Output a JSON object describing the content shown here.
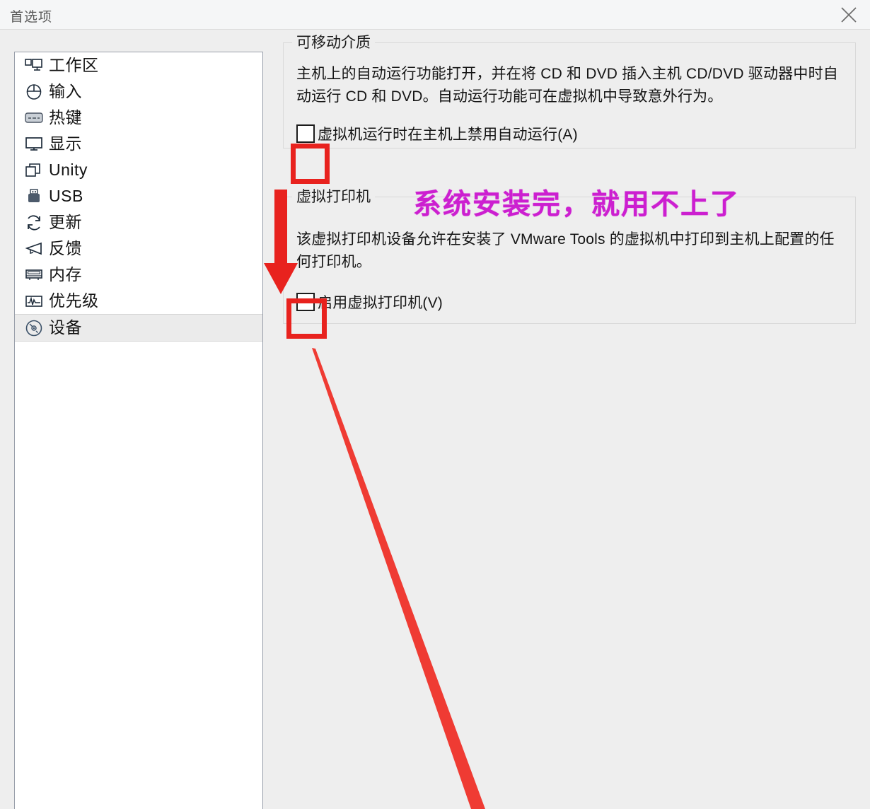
{
  "window": {
    "title": "首选项",
    "close_label": "×",
    "close_icon": "close-icon"
  },
  "sidebar": {
    "items": [
      {
        "label": "工作区",
        "icon": "workspace-icon",
        "selected": false
      },
      {
        "label": "输入",
        "icon": "mouse-icon",
        "selected": false
      },
      {
        "label": "热键",
        "icon": "keyboard-key-icon",
        "selected": false
      },
      {
        "label": "显示",
        "icon": "monitor-icon",
        "selected": false
      },
      {
        "label": "Unity",
        "icon": "windows-overlap-icon",
        "selected": false
      },
      {
        "label": "USB",
        "icon": "usb-stick-icon",
        "selected": false
      },
      {
        "label": "更新",
        "icon": "refresh-icon",
        "selected": false
      },
      {
        "label": "反馈",
        "icon": "megaphone-icon",
        "selected": false
      },
      {
        "label": "内存",
        "icon": "memory-module-icon",
        "selected": false
      },
      {
        "label": "优先级",
        "icon": "waveform-chart-icon",
        "selected": false
      },
      {
        "label": "设备",
        "icon": "disc-icon",
        "selected": true
      }
    ]
  },
  "main": {
    "groups": [
      {
        "legend": "可移动介质",
        "description": "主机上的自动运行功能打开，并在将 CD 和 DVD 插入主机 CD/DVD 驱动器中时自动运行 CD 和 DVD。自动运行功能可在虚拟机中导致意外行为。",
        "checkbox": {
          "label": "虚拟机运行时在主机上禁用自动运行(A)",
          "checked": false
        }
      },
      {
        "legend": "虚拟打印机",
        "description": "该虚拟打印机设备允许在安装了 VMware Tools 的虚拟机中打印到主机上配置的任何打印机。",
        "checkbox": {
          "label": "启用虚拟打印机(V)",
          "checked": false
        }
      }
    ]
  },
  "annotations": {
    "note_text": "系统安装完，就用不上了",
    "note_color": "#cc1fd0",
    "highlight_color": "#e8221e",
    "shapes": [
      {
        "name": "red-highlight-box-autorun-checkbox",
        "kind": "rect"
      },
      {
        "name": "red-highlight-box-printer-checkbox",
        "kind": "rect"
      },
      {
        "name": "red-arrow-down",
        "kind": "arrow"
      },
      {
        "name": "red-diagonal-stroke",
        "kind": "line"
      }
    ]
  }
}
